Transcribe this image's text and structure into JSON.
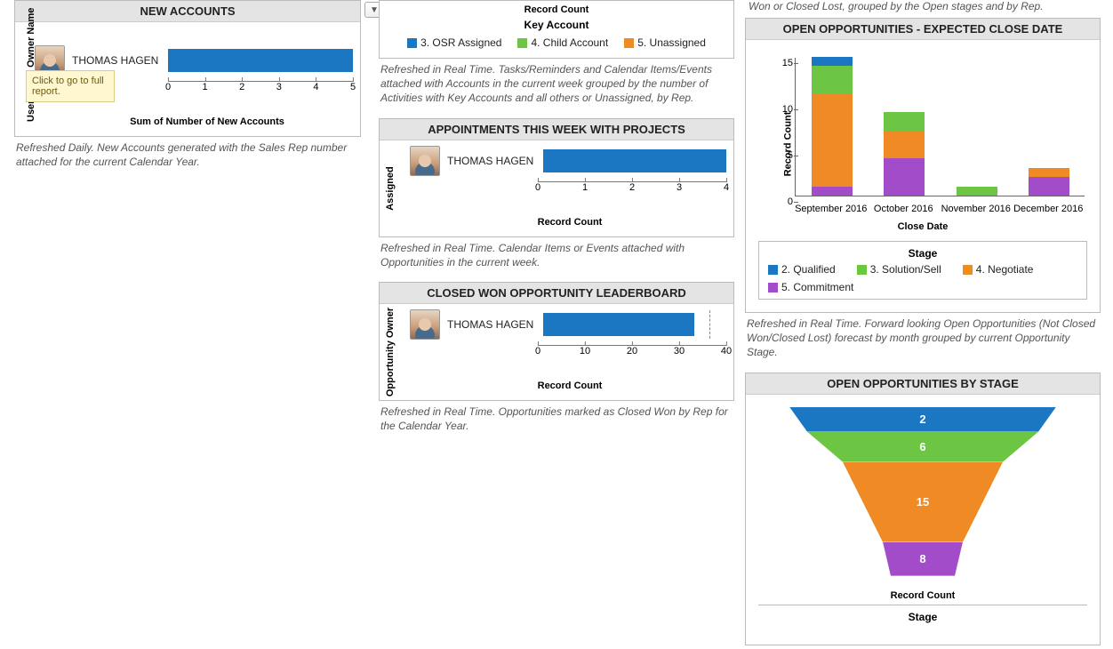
{
  "dropdown_glyph": "▼",
  "tooltip_text": "Click to go to full report.",
  "col1": {
    "new_accounts": {
      "title": "NEW ACCOUNTS",
      "ylabel": "User Stats: Owner Name",
      "row_name": "THOMAS HAGEN",
      "xlabel": "Sum of Number of New Accounts",
      "caption": "Refreshed Daily. New Accounts generated with the Sales Rep number attached for the current Calendar Year."
    }
  },
  "col2": {
    "key_account": {
      "partial_label": "Record Count",
      "legend_title": "Key Account",
      "items": [
        {
          "color": "#1b77c2",
          "label": "3. OSR Assigned"
        },
        {
          "color": "#6cc644",
          "label": "4. Child Account"
        },
        {
          "color": "#f08a24",
          "label": "5. Unassigned"
        }
      ],
      "caption": "Refreshed in Real Time. Tasks/Reminders and Calendar Items/Events attached with Accounts in the current week grouped by the number of Activities with Key Accounts and all others or Unassigned, by Rep."
    },
    "appointments": {
      "title": "APPOINTMENTS THIS WEEK WITH PROJECTS",
      "ylabel": "Assigned",
      "row_name": "THOMAS HAGEN",
      "xlabel": "Record Count",
      "caption": "Refreshed in Real Time. Calendar Items or Events attached with Opportunities in the current week."
    },
    "closed_won": {
      "title": "CLOSED WON OPPORTUNITY LEADERBOARD",
      "ylabel": "Opportunity Owner",
      "row_name": "THOMAS HAGEN",
      "xlabel": "Record Count",
      "caption": "Refreshed in Real Time. Opportunities marked as Closed Won by Rep for the Calendar Year."
    }
  },
  "col3": {
    "top_partial_caption": "Won or Closed Lost, grouped by the Open stages and by Rep.",
    "expected_close": {
      "title": "OPEN OPPORTUNITIES - EXPECTED CLOSE DATE",
      "ylabel": "Record Count",
      "xlabel": "Close Date",
      "legend_title": "Stage",
      "legend": [
        {
          "color": "#1b77c2",
          "label": "2. Qualified"
        },
        {
          "color": "#6cc644",
          "label": "3. Solution/Sell"
        },
        {
          "color": "#f08a24",
          "label": "4. Negotiate"
        },
        {
          "color": "#a24cc9",
          "label": "5. Commitment"
        }
      ],
      "caption": "Refreshed in Real Time. Forward looking Open Opportunities (Not Closed Won/Closed Lost) forecast by month grouped by current Opportunity Stage."
    },
    "by_stage": {
      "title": "OPEN OPPORTUNITIES BY STAGE",
      "xlabel": "Record Count",
      "legend_title": "Stage"
    }
  },
  "chart_data": [
    {
      "id": "new_accounts",
      "type": "bar",
      "orientation": "horizontal",
      "categories": [
        "THOMAS HAGEN"
      ],
      "values": [
        5
      ],
      "xlabel": "Sum of Number of New Accounts",
      "ylabel": "User Stats: Owner Name",
      "xlim": [
        0,
        5
      ],
      "xticks": [
        0,
        1,
        2,
        3,
        4,
        5
      ]
    },
    {
      "id": "appointments",
      "type": "bar",
      "orientation": "horizontal",
      "categories": [
        "THOMAS HAGEN"
      ],
      "values": [
        4
      ],
      "xlabel": "Record Count",
      "ylabel": "Assigned",
      "xlim": [
        0,
        4
      ],
      "xticks": [
        0,
        1,
        2,
        3,
        4
      ]
    },
    {
      "id": "closed_won",
      "type": "bar",
      "orientation": "horizontal",
      "categories": [
        "THOMAS HAGEN"
      ],
      "values": [
        33
      ],
      "xlabel": "Record Count",
      "ylabel": "Opportunity Owner",
      "xlim": [
        0,
        40
      ],
      "xticks": [
        0,
        10,
        20,
        30,
        40
      ]
    },
    {
      "id": "expected_close",
      "type": "bar",
      "stacked": true,
      "categories": [
        "September 2016",
        "October 2016",
        "November 2016",
        "December 2016"
      ],
      "series": [
        {
          "name": "2. Qualified",
          "color": "#1b77c2",
          "values": [
            1,
            0,
            0,
            0
          ]
        },
        {
          "name": "3. Solution/Sell",
          "color": "#6cc644",
          "values": [
            3,
            2,
            1,
            0
          ]
        },
        {
          "name": "4. Negotiate",
          "color": "#f08a24",
          "values": [
            10,
            3,
            0,
            1
          ]
        },
        {
          "name": "5. Commitment",
          "color": "#a24cc9",
          "values": [
            1,
            4,
            0,
            2
          ]
        }
      ],
      "xlabel": "Close Date",
      "ylabel": "Record Count",
      "ylim": [
        0,
        15
      ],
      "yticks": [
        0,
        5,
        10,
        15
      ]
    },
    {
      "id": "by_stage_funnel",
      "type": "funnel",
      "stages": [
        {
          "name": "2. Qualified",
          "color": "#1b77c2",
          "value": 2
        },
        {
          "name": "3. Solution/Sell",
          "color": "#6cc644",
          "value": 6
        },
        {
          "name": "4. Negotiate",
          "color": "#f08a24",
          "value": 15
        },
        {
          "name": "5. Commitment",
          "color": "#a24cc9",
          "value": 8
        }
      ],
      "xlabel": "Record Count",
      "legend_title": "Stage"
    }
  ]
}
